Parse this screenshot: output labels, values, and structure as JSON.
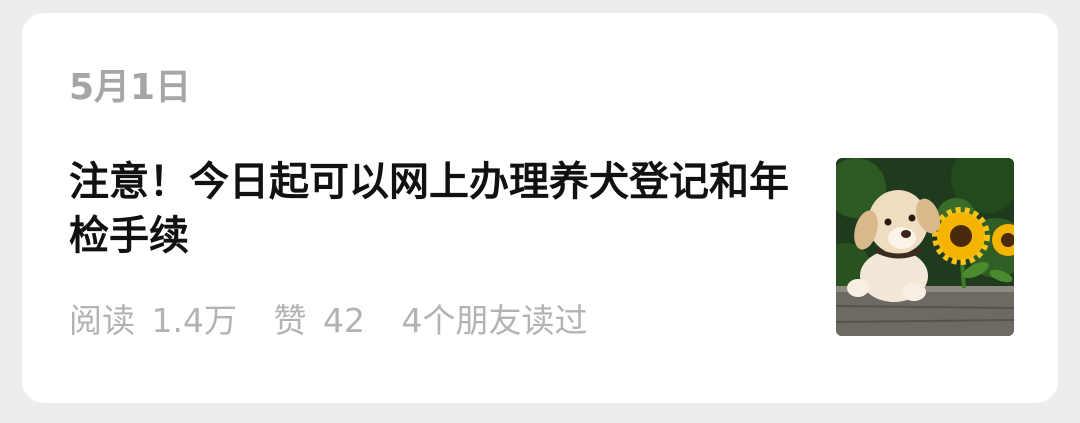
{
  "article": {
    "date": "5月1日",
    "title": "注意！今日起可以网上办理养犬登记和年检手续",
    "reads_label": "阅读",
    "reads_value": "1.4万",
    "likes_label": "赞",
    "likes_value": "42",
    "friends_read": "4个朋友读过"
  },
  "thumbnail": {
    "icon": "puppy-sunflower-photo"
  },
  "colors": {
    "background": "#ededed",
    "card": "#ffffff",
    "title": "#111111",
    "muted": "#a6a6a6"
  }
}
